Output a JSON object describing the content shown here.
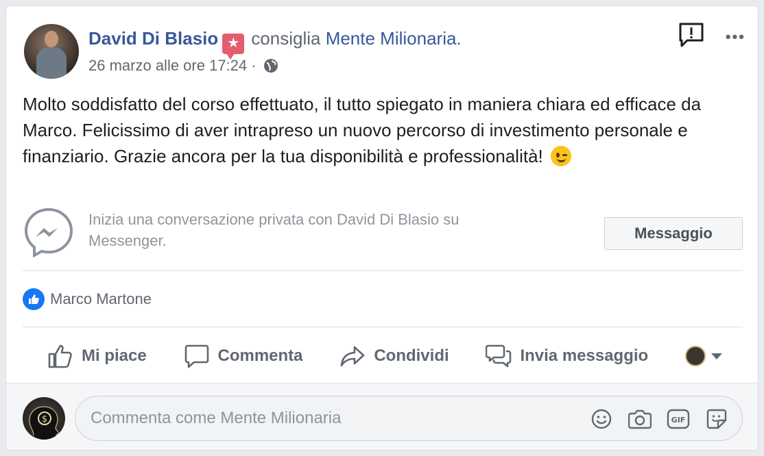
{
  "post": {
    "author": "David Di Blasio",
    "verb": "consiglia",
    "page": "Mente Milionaria.",
    "timestamp": "26 marzo alle ore 17:24 ·",
    "body": "Molto soddisfatto del corso effettuato, il tutto spiegato in maniera chiara ed efficace da Marco. Felicissimo di aver intrapreso un nuovo percorso di investimento personale e finanziario. Grazie ancora per la tua disponibilità e professionalità!",
    "emoji": "winking-face"
  },
  "messenger": {
    "prompt": "Inizia una conversazione privata con David Di Blasio su Messenger.",
    "button_label": "Messaggio"
  },
  "reactions": {
    "liked_by": "Marco Martone"
  },
  "actions": {
    "like": "Mi piace",
    "comment": "Commenta",
    "share": "Condividi",
    "send_message": "Invia messaggio"
  },
  "comment_box": {
    "placeholder": "Commenta come Mente Milionaria"
  },
  "colors": {
    "link": "#385898",
    "secondary_text": "#606770",
    "like_blue": "#1877f2",
    "badge_red": "#e55d6d"
  }
}
